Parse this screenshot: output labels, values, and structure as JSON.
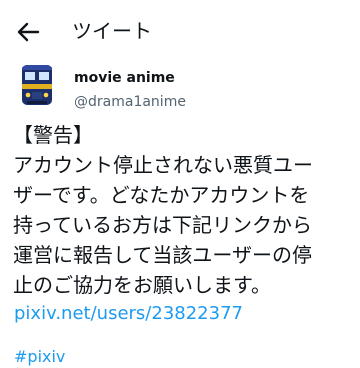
{
  "header": {
    "title": "ツイート",
    "back_icon": "arrow-left-icon"
  },
  "author": {
    "display_name": "movie anime",
    "handle": "@drama1anime",
    "avatar_icon": "train-avatar-icon"
  },
  "tweet": {
    "text": "【警告】\nアカウント停止されない悪質ユー\nザーです。どなたかアカウントを\n持っているお方は下記リンクから\n運営に報告して当該ユーザーの停\n止のご協力をお願いします。",
    "link": "pixiv.net/users/23822377",
    "hashtag_partial": "#pixiv"
  },
  "colors": {
    "text": "#0f1419",
    "secondary": "#536471",
    "link": "#1d9bf0"
  }
}
